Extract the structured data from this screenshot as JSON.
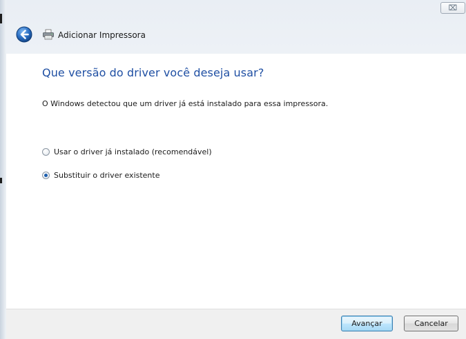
{
  "window": {
    "title": "Adicionar Impressora",
    "close_glyph": "⌧"
  },
  "page": {
    "heading": "Que versão do driver você deseja usar?",
    "description": "O Windows detectou que um driver já está instalado para essa impressora."
  },
  "options": [
    {
      "label": "Usar o driver já instalado (recomendável)",
      "checked": false
    },
    {
      "label": "Substituir o driver existente",
      "checked": true
    }
  ],
  "buttons": {
    "next_label": "Avançar",
    "cancel_label": "Cancelar"
  },
  "colors": {
    "heading": "#1f4fa3",
    "accent": "#1d5fae"
  }
}
